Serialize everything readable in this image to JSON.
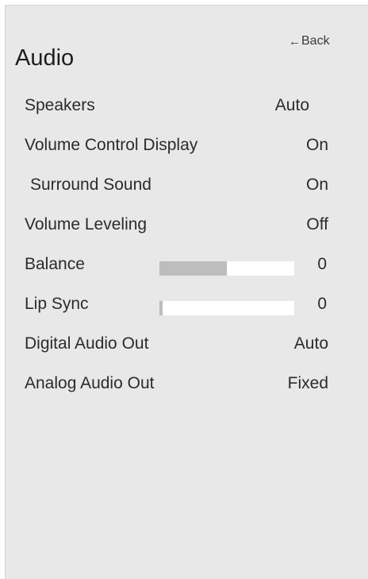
{
  "back_label": "Back",
  "title": "Audio",
  "menu": {
    "speakers": {
      "label": "Speakers",
      "value": "Auto"
    },
    "volume_control_display": {
      "label": "Volume Control Display",
      "value": "On"
    },
    "surround_sound": {
      "label": "Surround Sound",
      "value": "On"
    },
    "volume_leveling": {
      "label": "Volume Leveling",
      "value": "Off"
    },
    "balance": {
      "label": "Balance",
      "value": "0",
      "slider_level": 0.5
    },
    "lip_sync": {
      "label": "Lip Sync",
      "value": "0",
      "slider_level": 0.02
    },
    "digital_audio_out": {
      "label": "Digital Audio Out",
      "value": "Auto"
    },
    "analog_audio_out": {
      "label": "Analog Audio Out",
      "value": "Fixed"
    }
  },
  "colors": {
    "panel_background": "#e8e8e8",
    "slider_track": "#ffffff",
    "slider_fill": "#bdbdbd",
    "text": "#2b2b2b"
  },
  "icons": {
    "back": "left-arrow-icon"
  }
}
